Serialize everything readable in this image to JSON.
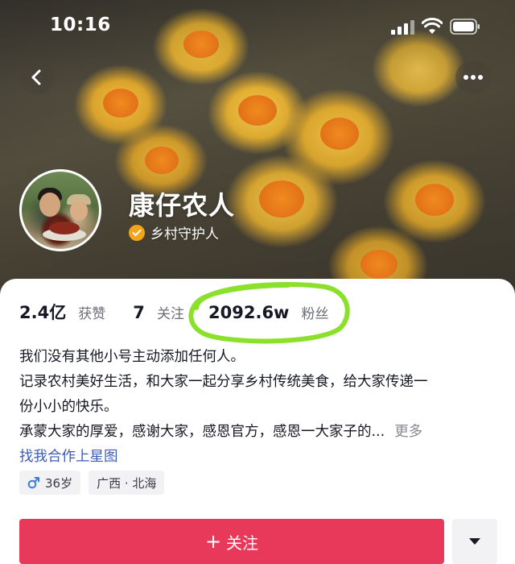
{
  "status_bar": {
    "time": "10:16"
  },
  "profile": {
    "name": "康仔农人",
    "verification": "乡村守护人"
  },
  "stats": {
    "likes": {
      "value": "2.4亿",
      "label": "获赞"
    },
    "following": {
      "value": "7",
      "label": "关注"
    },
    "followers": {
      "value": "2092.6w",
      "label": "粉丝"
    }
  },
  "bio": {
    "lines": [
      "我们没有其他小号主动添加任何人。",
      "记录农村美好生活，和大家一起分享乡村传统美食，给大家传递一",
      "份小小的快乐。",
      "承蒙大家的厚爱，感谢大家，感恩官方，感恩一大家子的..."
    ],
    "more_label": "更多",
    "link": "找我合作上星图"
  },
  "tags": {
    "age": "36岁",
    "location": "广西 · 北海"
  },
  "actions": {
    "follow_label": "关注",
    "follow_plus": "+"
  },
  "colors": {
    "follow_button": "#e9395a",
    "highlight_ring": "#8be02c",
    "link": "#3b5bb5",
    "verify_badge": "#f2a516"
  },
  "icons": [
    "back-arrow-icon",
    "more-dots-icon",
    "signal-icon",
    "wifi-icon",
    "battery-icon",
    "verified-check-icon",
    "male-icon",
    "chevron-down-icon"
  ]
}
